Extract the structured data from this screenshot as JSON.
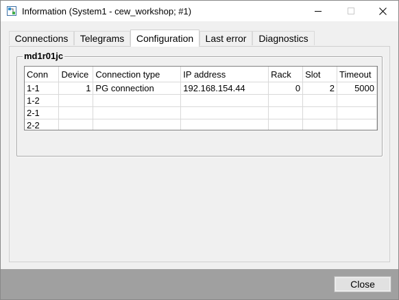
{
  "window": {
    "title": "Information (System1 - cew_workshop; #1)"
  },
  "tabs": [
    {
      "label": "Connections"
    },
    {
      "label": "Telegrams"
    },
    {
      "label": "Configuration"
    },
    {
      "label": "Last error"
    },
    {
      "label": "Diagnostics"
    }
  ],
  "active_tab": "Configuration",
  "group": {
    "title": "md1r01jc"
  },
  "table": {
    "columns": [
      "Conn",
      "Device",
      "Connection type",
      "IP address",
      "Rack",
      "Slot",
      "Timeout"
    ],
    "rows": [
      [
        "1-1",
        "1",
        "PG connection",
        "192.168.154.44",
        "0",
        "2",
        "5000"
      ],
      [
        "1-2",
        "",
        "",
        "",
        "",
        "",
        ""
      ],
      [
        "2-1",
        "",
        "",
        "",
        "",
        "",
        ""
      ],
      [
        "2-2",
        "",
        "",
        "",
        "",
        "",
        ""
      ]
    ]
  },
  "footer": {
    "close_label": "Close"
  }
}
